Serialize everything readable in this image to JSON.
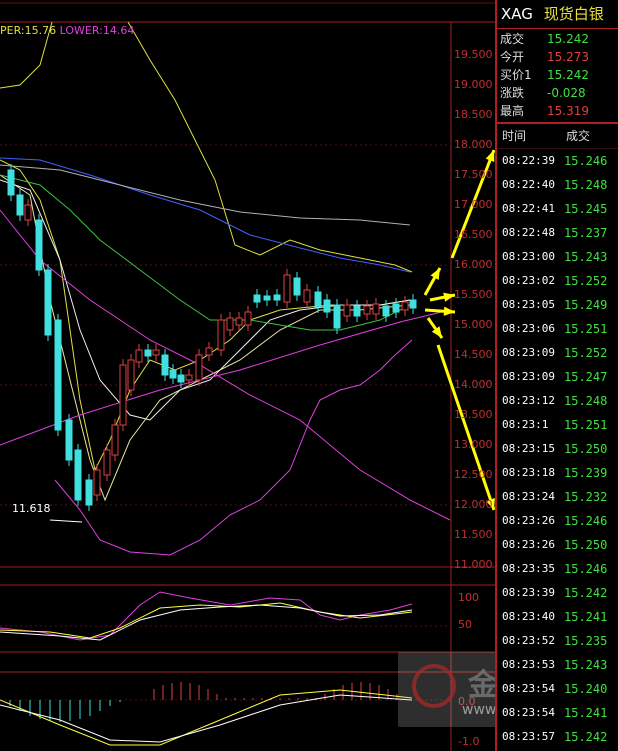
{
  "indicator": {
    "upper_label": "PER:15.76",
    "lower_label": "LOWER:14.64"
  },
  "price_axis": [
    "19.500",
    "19.000",
    "18.500",
    "18.000",
    "17.500",
    "17.000",
    "16.500",
    "16.000",
    "15.500",
    "15.000",
    "14.500",
    "14.000",
    "13.500",
    "13.000",
    "12.500",
    "12.000",
    "11.500",
    "11.000"
  ],
  "min_marker": "11.618",
  "osc1_axis": [
    "100",
    "50"
  ],
  "osc2_axis": [
    "0.0",
    "-1.0"
  ],
  "colors": {
    "up": "#e04040",
    "down": "#40e0e0",
    "upper_band": "#e0e040",
    "lower_band": "#e040e0",
    "arrow": "#ffff00"
  },
  "panel": {
    "symbol": "XAG",
    "name": "现货白银",
    "quotes": [
      {
        "label": "成交",
        "value": "15.242",
        "color": "green"
      },
      {
        "label": "今开",
        "value": "15.273",
        "color": "red"
      },
      {
        "label": "买价1",
        "value": "15.242",
        "color": "green"
      },
      {
        "label": "涨跌",
        "value": "-0.028",
        "color": "green"
      },
      {
        "label": "最高",
        "value": "15.319",
        "color": "red"
      }
    ],
    "header_time": "时间",
    "header_price": "成交",
    "ticks": [
      {
        "time": "08:22:39",
        "price": "15.246"
      },
      {
        "time": "08:22:40",
        "price": "15.248"
      },
      {
        "time": "08:22:41",
        "price": "15.245"
      },
      {
        "time": "08:22:48",
        "price": "15.237"
      },
      {
        "time": "08:23:00",
        "price": "15.243"
      },
      {
        "time": "08:23:02",
        "price": "15.252"
      },
      {
        "time": "08:23:05",
        "price": "15.249"
      },
      {
        "time": "08:23:06",
        "price": "15.251"
      },
      {
        "time": "08:23:09",
        "price": "15.252"
      },
      {
        "time": "08:23:09",
        "price": "15.247"
      },
      {
        "time": "08:23:12",
        "price": "15.248"
      },
      {
        "time": "08:23:1",
        "price": "15.251"
      },
      {
        "time": "08:23:15",
        "price": "15.250"
      },
      {
        "time": "08:23:18",
        "price": "15.239"
      },
      {
        "time": "08:23:24",
        "price": "15.232"
      },
      {
        "time": "08:23:26",
        "price": "15.246"
      },
      {
        "time": "08:23:26",
        "price": "15.250"
      },
      {
        "time": "08:23:35",
        "price": "15.246"
      },
      {
        "time": "08:23:39",
        "price": "15.242"
      },
      {
        "time": "08:23:40",
        "price": "15.241"
      },
      {
        "time": "08:23:52",
        "price": "15.235"
      },
      {
        "time": "08:23:53",
        "price": "15.243"
      },
      {
        "time": "08:23:54",
        "price": "15.240"
      },
      {
        "time": "08:23:54",
        "price": "15.241"
      },
      {
        "time": "08:23:57",
        "price": "15.242"
      }
    ]
  },
  "watermark": {
    "text": "金",
    "url": "www.jrwei.com"
  }
}
